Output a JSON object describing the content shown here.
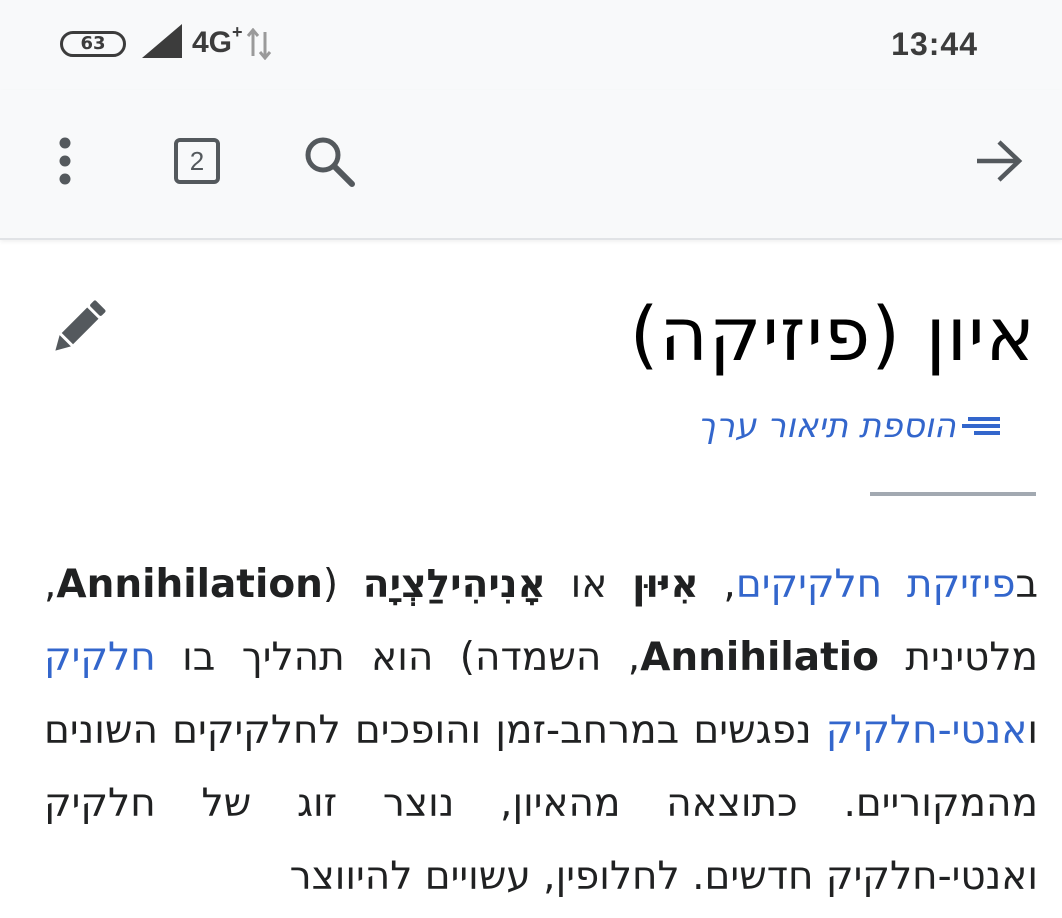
{
  "status_bar": {
    "battery": "63",
    "network": "4G",
    "network_sup": "+",
    "time": "13:44"
  },
  "toolbar": {
    "tabs_count": "2",
    "icons": [
      "more-vertical-icon",
      "tabs-icon",
      "search-icon",
      "forward-arrow-icon"
    ]
  },
  "article": {
    "title": "איון (פיזיקה)",
    "add_description": "הוספת תיאור ערך",
    "intro": {
      "p1": "ב",
      "link_particle_physics": "פיזיקת חלקיקים",
      "p2": ", ",
      "term1": "אִיּוּן",
      "p3": " או ",
      "term2": "אָנִיהִילַצְיָה",
      "p4": " (",
      "term_en": "Annihilation",
      "p5": ", מלטינית ",
      "term_la": "Annihilatio",
      "p6": ", השמדה) הוא תהליך בו ",
      "link_particle": "חלקיק",
      "p7": " ו",
      "link_antiparticle": "אנטי-חלקיק",
      "p8": " נפגשים במרחב-זמן והופכים לחלקיקים השונים מהמקוריים. כתוצאה מהאיון, נוצר זוג של חלקיק ואנטי-חלקיק חדשים. לחלופין, עשויים להיווצר"
    }
  },
  "colors": {
    "link": "#3366cc",
    "toolbar_bg": "#f8f9fa",
    "icon": "#54595d"
  }
}
